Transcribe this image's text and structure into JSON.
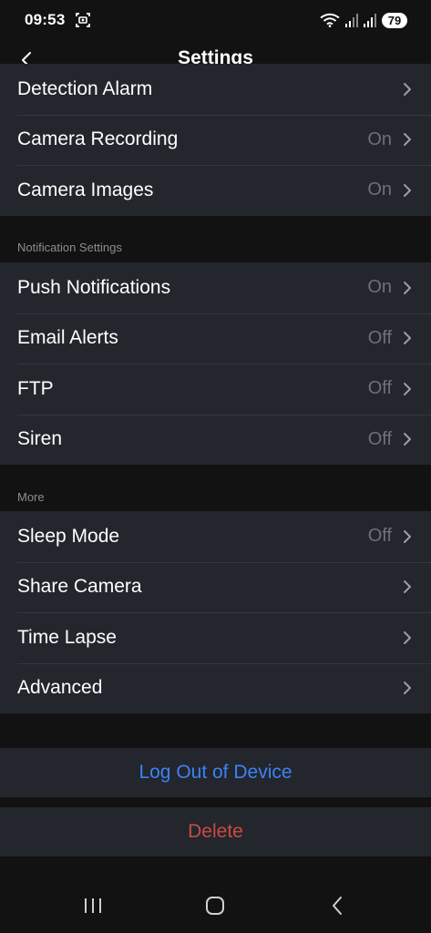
{
  "status_bar": {
    "time": "09:53",
    "battery": "79"
  },
  "nav": {
    "title": "Settings"
  },
  "groups": {
    "top": [
      {
        "label": "Detection Alarm",
        "value": ""
      },
      {
        "label": "Camera Recording",
        "value": "On"
      },
      {
        "label": "Camera Images",
        "value": "On"
      }
    ],
    "notification_header": "Notification Settings",
    "notification": [
      {
        "label": "Push Notifications",
        "value": "On"
      },
      {
        "label": "Email Alerts",
        "value": "Off"
      },
      {
        "label": "FTP",
        "value": "Off"
      },
      {
        "label": "Siren",
        "value": "Off"
      }
    ],
    "more_header": "More",
    "more": [
      {
        "label": "Sleep Mode",
        "value": "Off"
      },
      {
        "label": "Share Camera",
        "value": ""
      },
      {
        "label": "Time Lapse",
        "value": ""
      },
      {
        "label": "Advanced",
        "value": ""
      }
    ]
  },
  "actions": {
    "logout_label": "Log Out of Device",
    "delete_label": "Delete"
  },
  "colors": {
    "accent": "#3b82f6",
    "danger": "#cc4a44",
    "background": "#121212",
    "row": "#23262c"
  },
  "icons": [
    "screen-record-icon",
    "wifi-icon",
    "signal-icon",
    "back-chevron-icon",
    "chevron-right-icon",
    "recents-icon",
    "home-icon",
    "system-back-icon"
  ]
}
